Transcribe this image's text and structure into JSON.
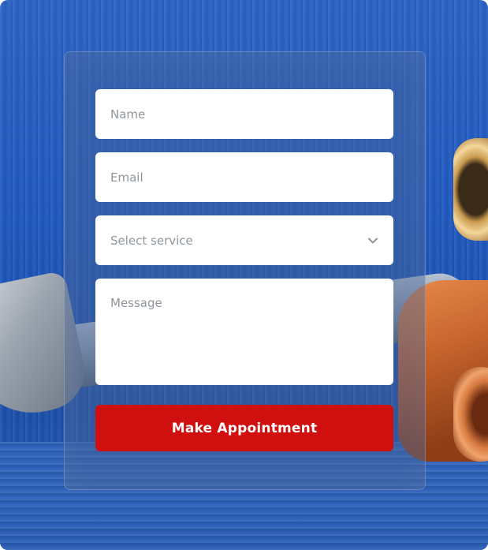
{
  "form": {
    "name_placeholder": "Name",
    "email_placeholder": "Email",
    "service_placeholder": "Select service",
    "message_placeholder": "Message",
    "submit_label": "Make Appointment"
  },
  "colors": {
    "accent": "#d0100f",
    "input_bg": "#ffffff",
    "placeholder": "#8f959c"
  },
  "icons": {
    "select_chevron": "chevron-down-icon"
  }
}
